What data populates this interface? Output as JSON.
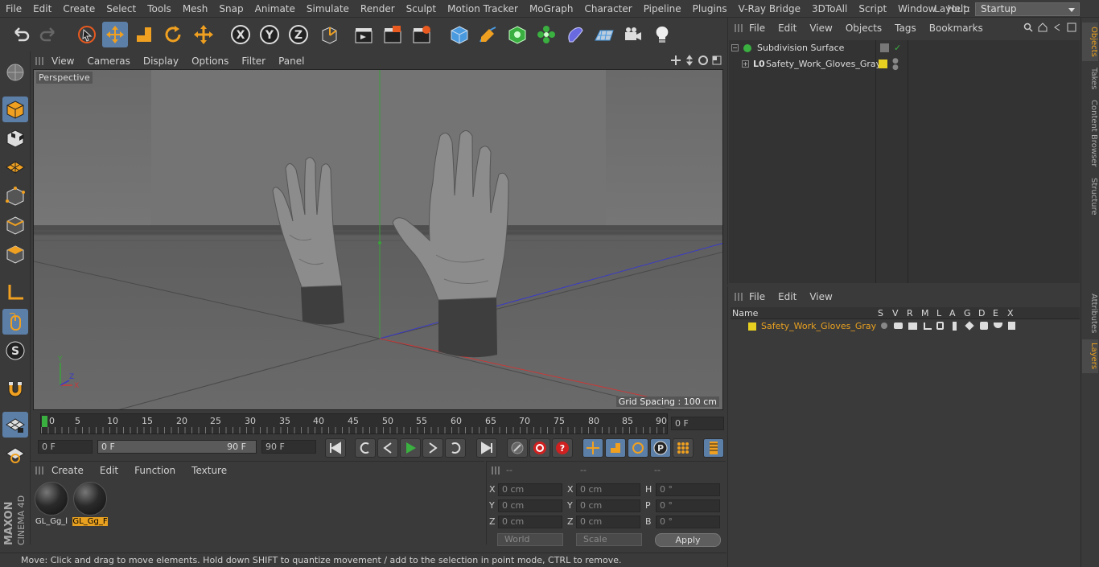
{
  "menubar": {
    "items": [
      "File",
      "Edit",
      "Create",
      "Select",
      "Tools",
      "Mesh",
      "Snap",
      "Animate",
      "Simulate",
      "Render",
      "Sculpt",
      "Motion Tracker",
      "MoGraph",
      "Character",
      "Pipeline",
      "Plugins",
      "V-Ray Bridge",
      "3DToAll",
      "Script",
      "Window",
      "Help"
    ],
    "layout_label": "Layout:",
    "layout_value": "Startup"
  },
  "viewport": {
    "menu": [
      "View",
      "Cameras",
      "Display",
      "Options",
      "Filter",
      "Panel"
    ],
    "label": "Perspective",
    "grid_spacing": "Grid Spacing : 100 cm"
  },
  "timeline": {
    "ticks": [
      "0",
      "5",
      "10",
      "15",
      "20",
      "25",
      "30",
      "35",
      "40",
      "45",
      "50",
      "55",
      "60",
      "65",
      "70",
      "75",
      "80",
      "85",
      "90"
    ],
    "current_frame": "0 F"
  },
  "controls": {
    "start_field": "0 F",
    "range_start": "0 F",
    "range_end": "90 F",
    "end_field": "90 F"
  },
  "materials": {
    "menu": [
      "Create",
      "Edit",
      "Function",
      "Texture"
    ],
    "items": [
      {
        "label": "GL_Gg_l"
      },
      {
        "label": "GL_Gg_F"
      }
    ]
  },
  "coords": {
    "headers": [
      "--",
      "--",
      "--"
    ],
    "rows": [
      {
        "a": "X",
        "av": "0 cm",
        "b": "X",
        "bv": "0 cm",
        "c": "H",
        "cv": "0 °"
      },
      {
        "a": "Y",
        "av": "0 cm",
        "b": "Y",
        "bv": "0 cm",
        "c": "P",
        "cv": "0 °"
      },
      {
        "a": "Z",
        "av": "0 cm",
        "b": "Z",
        "bv": "0 cm",
        "c": "B",
        "cv": "0 °"
      }
    ],
    "world": "World",
    "scale": "Scale",
    "apply": "Apply"
  },
  "status": "Move: Click and drag to move elements. Hold down SHIFT to quantize movement / add to the selection in point mode, CTRL to remove.",
  "objects_panel": {
    "menu": [
      "File",
      "Edit",
      "View",
      "Objects",
      "Tags",
      "Bookmarks"
    ],
    "items": [
      {
        "name": "Subdivision Surface"
      },
      {
        "name": "Safety_Work_Gloves_Gray"
      }
    ]
  },
  "layers_panel": {
    "menu": [
      "File",
      "Edit",
      "View"
    ],
    "columns": [
      "Name",
      "S",
      "V",
      "R",
      "M",
      "L",
      "A",
      "G",
      "D",
      "E",
      "X"
    ],
    "layer_name": "Safety_Work_Gloves_Gray",
    "layer_color": "#e8d020"
  },
  "right_tabs": [
    "Objects",
    "Takes",
    "Content Browser",
    "Structure",
    "Attributes",
    "Layers"
  ],
  "colors": {
    "accent": "#5c7fa8",
    "selection": "#e8a020"
  }
}
